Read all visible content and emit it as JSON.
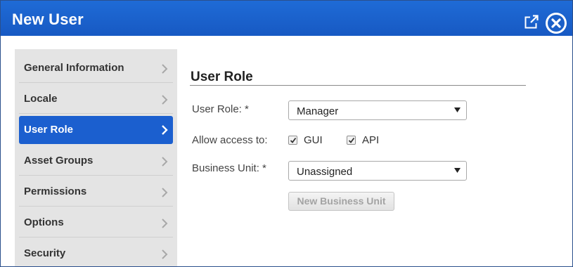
{
  "dialog": {
    "title": "New User"
  },
  "icons": {
    "expand": "expand-window-icon",
    "close": "close-icon",
    "chevron": "chevron-right-icon",
    "dropdown": "dropdown-arrow-icon",
    "check": "checkmark-icon"
  },
  "colors": {
    "titlebar": "#1f6bd6",
    "active_nav": "#1b5fcf",
    "sidebar_bg": "#e4e4e4"
  },
  "sidebar": {
    "items": [
      {
        "label": "General Information",
        "active": false
      },
      {
        "label": "Locale",
        "active": false
      },
      {
        "label": "User Role",
        "active": true
      },
      {
        "label": "Asset Groups",
        "active": false
      },
      {
        "label": "Permissions",
        "active": false
      },
      {
        "label": "Options",
        "active": false
      },
      {
        "label": "Security",
        "active": false
      }
    ]
  },
  "content": {
    "heading": "User Role",
    "user_role": {
      "label": "User Role: *",
      "value": "Manager"
    },
    "allow_access": {
      "label": "Allow access to:",
      "gui": {
        "label": "GUI",
        "checked": true
      },
      "api": {
        "label": "API",
        "checked": true
      }
    },
    "business_unit": {
      "label": "Business Unit: *",
      "value": "Unassigned"
    },
    "new_business_unit_button": "New Business Unit"
  }
}
